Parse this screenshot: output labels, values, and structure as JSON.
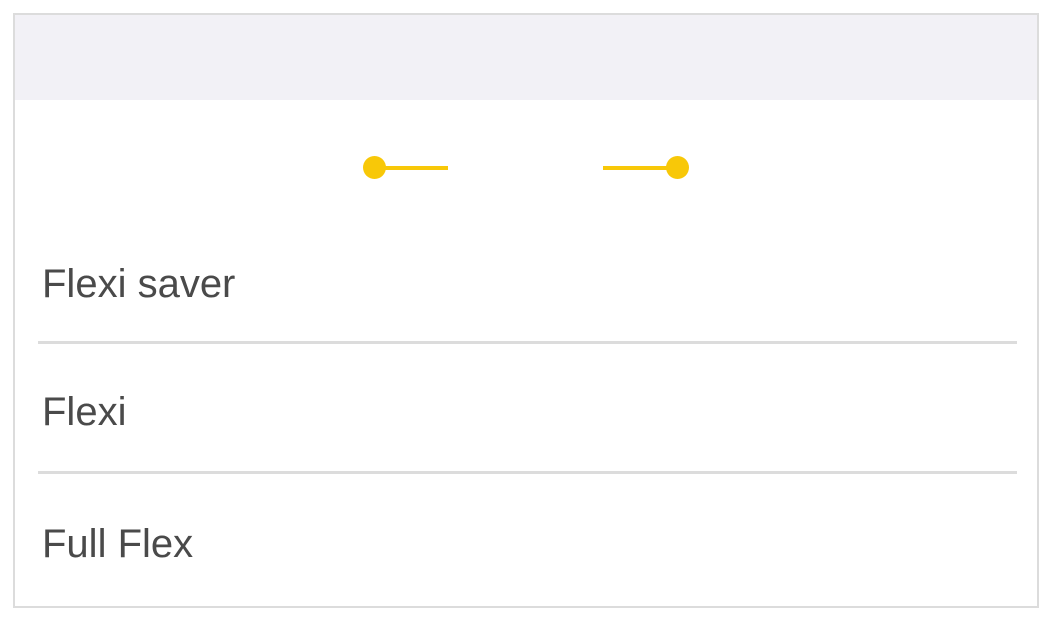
{
  "theme": {
    "accent": "#f8c808",
    "text": "#4a4a4a",
    "header_bg": "#f2f1f6",
    "divider": "#dcdcdc"
  },
  "fare_options": [
    {
      "label": "Flexi saver"
    },
    {
      "label": "Flexi"
    },
    {
      "label": "Full Flex"
    }
  ]
}
